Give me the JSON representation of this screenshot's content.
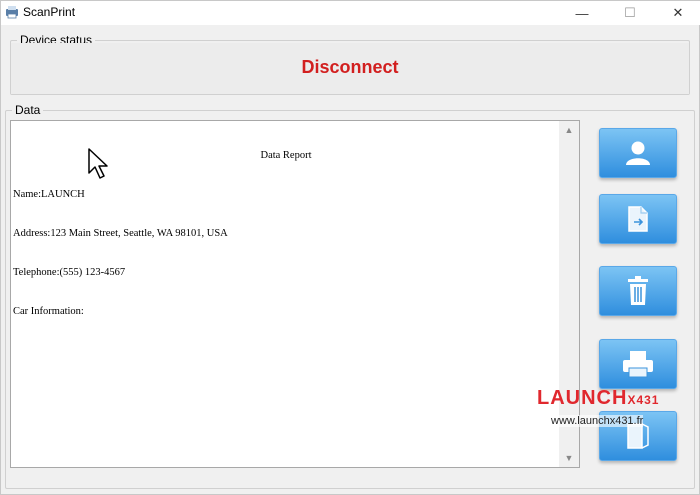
{
  "window": {
    "title": "ScanPrint",
    "controls": {
      "minimize": "—",
      "maximize": "☐",
      "close": "✕"
    }
  },
  "device_status": {
    "legend": "Device status",
    "status": "Disconnect",
    "status_color": "#d21f1f"
  },
  "data": {
    "legend": "Data",
    "report_title": "Data Report",
    "lines": [
      "Name:LAUNCH",
      "Address:123 Main Street, Seattle, WA 98101, USA",
      "Telephone:(555) 123-4567",
      "Car Information:"
    ]
  },
  "buttons": [
    {
      "name": "user-button",
      "icon": "user-icon"
    },
    {
      "name": "file-button",
      "icon": "document-icon"
    },
    {
      "name": "delete-button",
      "icon": "trash-icon"
    },
    {
      "name": "print-button",
      "icon": "printer-icon"
    },
    {
      "name": "exit-button",
      "icon": "exit-icon"
    }
  ],
  "watermark": {
    "brand": "LAUNCH",
    "model": "X431",
    "url": "www.launchx431.fr"
  },
  "colors": {
    "button_gradient_top": "#7cc4f4",
    "button_gradient_bottom": "#2f8ede",
    "brand_red": "#e0282e"
  }
}
